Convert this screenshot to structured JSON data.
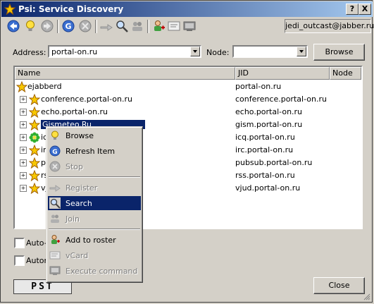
{
  "window": {
    "title": "Psi: Service Discovery",
    "help_button": "?",
    "close_button": "X"
  },
  "toolbar": {
    "account_jid": "jedi_outcast@jabber.ru",
    "icons": [
      "back-icon",
      "lightbulb-icon",
      "forward-icon",
      "refresh-icon",
      "stop-icon",
      "register-icon",
      "search-icon",
      "join-icon",
      "add-roster-icon",
      "vcard-icon",
      "execute-icon"
    ]
  },
  "address": {
    "label": "Address:",
    "value": "portal-on.ru",
    "node_label": "Node:",
    "node_value": "",
    "browse_button": "Browse"
  },
  "tree": {
    "columns": [
      "Name",
      "JID",
      "Node"
    ],
    "root": {
      "name": "ejabberd",
      "jid": "portal-on.ru"
    },
    "items": [
      {
        "name": "conference.portal-on.ru",
        "jid": "conference.portal-on.ru",
        "icon": "star-icon",
        "selected": false
      },
      {
        "name": "echo.portal-on.ru",
        "jid": "echo.portal-on.ru",
        "icon": "star-icon",
        "selected": false
      },
      {
        "name": "Gismeteo.Ru",
        "jid": "gism.portal-on.ru",
        "icon": "star-icon",
        "selected": true
      },
      {
        "name": "ic",
        "jid": "icq.portal-on.ru",
        "icon": "icq-flower-icon",
        "selected": false
      },
      {
        "name": "ir",
        "jid": "irc.portal-on.ru",
        "icon": "star-icon",
        "selected": false
      },
      {
        "name": "pu",
        "jid": "pubsub.portal-on.ru",
        "icon": "star-icon",
        "selected": false
      },
      {
        "name": "rs",
        "jid": "rss.portal-on.ru",
        "icon": "star-icon",
        "selected": false
      },
      {
        "name": "vj",
        "jid": "vjud.portal-on.ru",
        "icon": "star-icon",
        "selected": false
      }
    ]
  },
  "context_menu": {
    "items": [
      {
        "label": "Browse",
        "icon": "lightbulb-icon",
        "disabled": false,
        "highlighted": false
      },
      {
        "label": "Refresh Item",
        "icon": "refresh-icon",
        "disabled": false,
        "highlighted": false
      },
      {
        "label": "Stop",
        "icon": "stop-icon",
        "disabled": true,
        "highlighted": false
      },
      {
        "label": "Register",
        "icon": "register-icon",
        "disabled": true,
        "highlighted": false
      },
      {
        "label": "Search",
        "icon": "search-icon",
        "disabled": false,
        "highlighted": true
      },
      {
        "label": "Join",
        "icon": "join-icon",
        "disabled": true,
        "highlighted": false
      },
      {
        "label": "Add to roster",
        "icon": "add-roster-icon",
        "disabled": false,
        "highlighted": false
      },
      {
        "label": "vCard",
        "icon": "vcard-icon",
        "disabled": true,
        "highlighted": false
      },
      {
        "label": "Execute command",
        "icon": "execute-icon",
        "disabled": true,
        "highlighted": false
      }
    ]
  },
  "options": {
    "auto_browse": "Auto-b",
    "auto_item": "Autom"
  },
  "footer": {
    "logo": "PST",
    "close_button": "Close"
  }
}
